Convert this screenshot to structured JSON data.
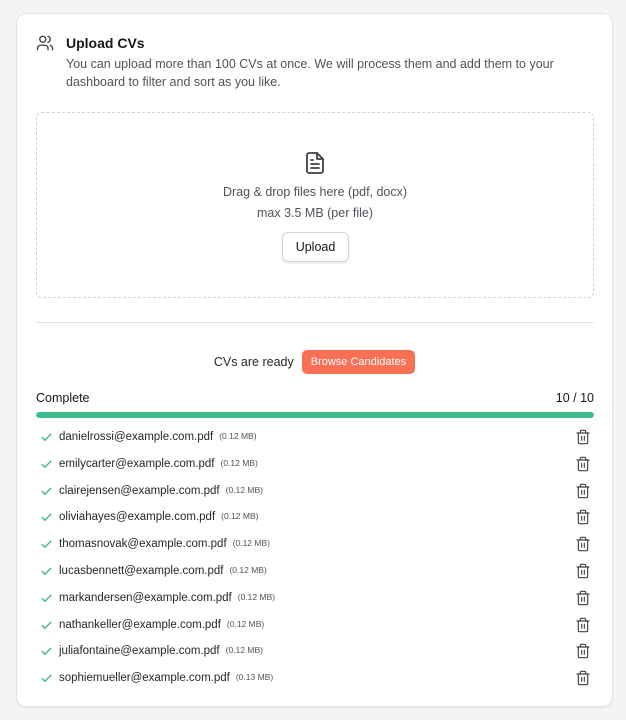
{
  "header": {
    "title": "Upload CVs",
    "description": "You can upload more than 100 CVs at once. We will process them and add them to your dashboard to filter and sort as you like."
  },
  "dropzone": {
    "line1": "Drag & drop files here (pdf, docx)",
    "line2": "max 3.5 MB (per file)",
    "upload_label": "Upload"
  },
  "ready": {
    "text": "CVs are ready",
    "browse_label": "Browse Candidates"
  },
  "status": {
    "label": "Complete",
    "count": "10 / 10",
    "progress_fraction": 1.0
  },
  "colors": {
    "accent": "#f97054",
    "progress": "#3dbd8c",
    "check": "#3dbd8c"
  },
  "files": [
    {
      "name": "danielrossi@example.com.pdf",
      "size": "(0.12 MB)"
    },
    {
      "name": "emilycarter@example.com.pdf",
      "size": "(0.12 MB)"
    },
    {
      "name": "clairejensen@example.com.pdf",
      "size": "(0.12 MB)"
    },
    {
      "name": "oliviahayes@example.com.pdf",
      "size": "(0.12 MB)"
    },
    {
      "name": "thomasnovak@example.com.pdf",
      "size": "(0.12 MB)"
    },
    {
      "name": "lucasbennett@example.com.pdf",
      "size": "(0.12 MB)"
    },
    {
      "name": "markandersen@example.com.pdf",
      "size": "(0.12 MB)"
    },
    {
      "name": "nathankeller@example.com.pdf",
      "size": "(0.12 MB)"
    },
    {
      "name": "juliafontaine@example.com.pdf",
      "size": "(0.12 MB)"
    },
    {
      "name": "sophiemueller@example.com.pdf",
      "size": "(0.13 MB)"
    }
  ]
}
